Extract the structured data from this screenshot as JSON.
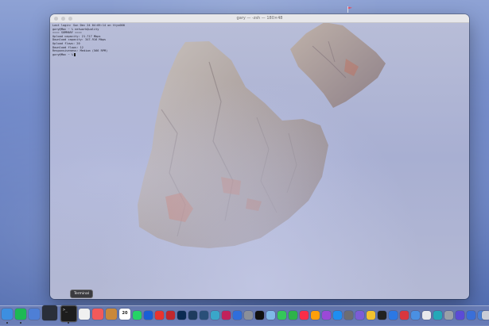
{
  "window": {
    "title": "gary — -zsh — 180×48",
    "terminal_lines": [
      "Last login: Sun Dec 24 04:05:14 on ttys000",
      "gary@Mac ~ % networkQuality",
      "==== SUMMARY ====",
      "Upload capacity: 21.717 Mbps",
      "Download capacity: 347.916 Mbps",
      "Upload flows: 20",
      "Download flows: 12",
      "Responsiveness: Medium (566 RPM)",
      "gary@Mac ~ %"
    ]
  },
  "dock": {
    "tooltip": "Terminal",
    "calendar_day": "20",
    "apps": [
      {
        "name": "finder",
        "color": "#3d8fe0"
      },
      {
        "name": "spotify",
        "color": "#1db954"
      },
      {
        "name": "app-blue",
        "color": "#4e7fd6"
      },
      {
        "name": "cursor",
        "color": "#2a2f3a"
      },
      {
        "name": "terminal",
        "color": "#1d1d1d"
      },
      {
        "name": "app-white",
        "color": "#f0f0f0"
      },
      {
        "name": "klarna",
        "color": "#f25a5a"
      },
      {
        "name": "app-brown",
        "color": "#c9883a"
      },
      {
        "name": "calendar",
        "color": "#ffffff"
      },
      {
        "name": "whatsapp",
        "color": "#25d366"
      },
      {
        "name": "app-darkblue",
        "color": "#1a5fd6"
      },
      {
        "name": "app-red",
        "color": "#e8342f"
      },
      {
        "name": "filezilla",
        "color": "#c1272d"
      },
      {
        "name": "photoshop",
        "color": "#0b2b52"
      },
      {
        "name": "lightroom",
        "color": "#1e3b5e"
      },
      {
        "name": "lightroom-classic",
        "color": "#2a4f78"
      },
      {
        "name": "app-teal",
        "color": "#3aa7c9"
      },
      {
        "name": "app-pink",
        "color": "#c2215c"
      },
      {
        "name": "app-blue2",
        "color": "#2f6edb"
      },
      {
        "name": "app-gray",
        "color": "#8a8f99"
      },
      {
        "name": "appletv",
        "color": "#111111"
      },
      {
        "name": "app-lightblue",
        "color": "#7fb9e8"
      },
      {
        "name": "app-green",
        "color": "#34c759"
      },
      {
        "name": "app-green2",
        "color": "#2db34a"
      },
      {
        "name": "music",
        "color": "#fa2d48"
      },
      {
        "name": "app-orange",
        "color": "#ff9f0a"
      },
      {
        "name": "podcasts",
        "color": "#9b49d8"
      },
      {
        "name": "app-blue3",
        "color": "#1f8ef1"
      },
      {
        "name": "app-gray2",
        "color": "#6d6d72"
      },
      {
        "name": "app-purple",
        "color": "#7c5cd6"
      },
      {
        "name": "app-yellow",
        "color": "#f2c230"
      },
      {
        "name": "app-black",
        "color": "#222222"
      },
      {
        "name": "app-blue4",
        "color": "#2b78e4"
      },
      {
        "name": "app-red2",
        "color": "#d9363e"
      },
      {
        "name": "app-blue5",
        "color": "#4a90e2"
      },
      {
        "name": "app-white2",
        "color": "#e8e8ec"
      },
      {
        "name": "app-teal2",
        "color": "#25a8b8"
      },
      {
        "name": "app-gray3",
        "color": "#9aa0a8"
      },
      {
        "name": "app-purple2",
        "color": "#5b4bd6"
      },
      {
        "name": "app-blue6",
        "color": "#3a6fd8"
      },
      {
        "name": "downloads",
        "color": "#4a7fd6"
      },
      {
        "name": "trash",
        "color": "#c8ccd6"
      }
    ]
  }
}
